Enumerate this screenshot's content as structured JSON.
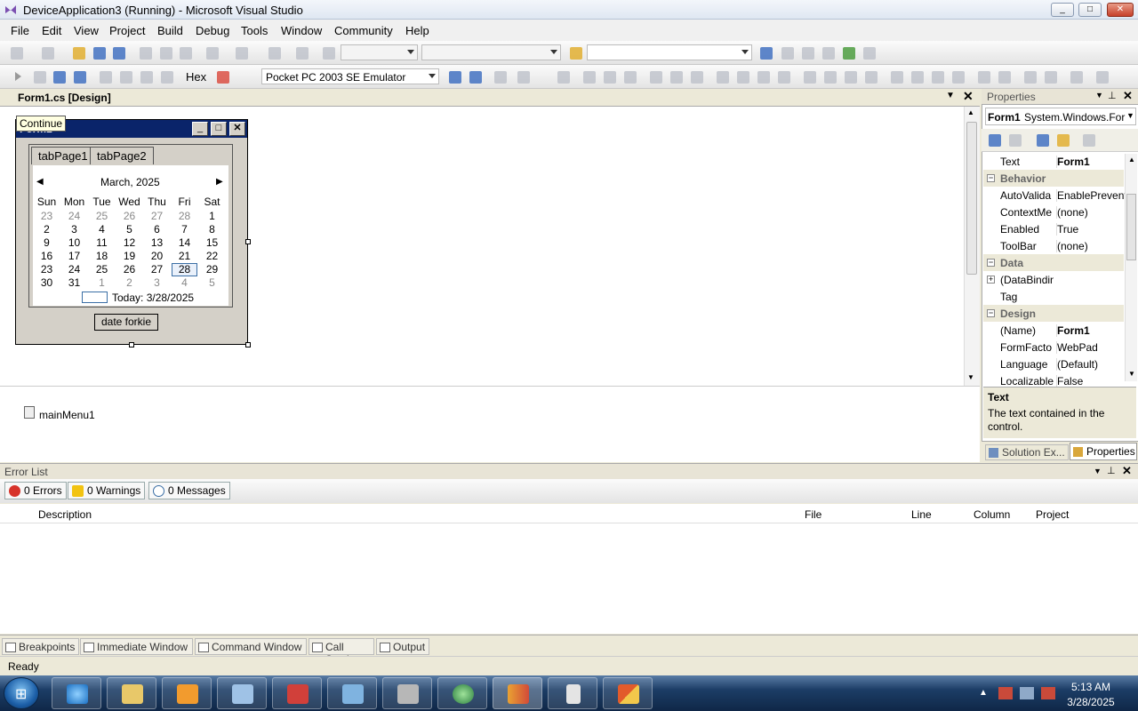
{
  "window": {
    "title": "DeviceApplication3 (Running) - Microsoft Visual Studio",
    "minimize": "_",
    "maximize": "□",
    "close": "✕"
  },
  "menu": [
    "File",
    "Edit",
    "View",
    "Project",
    "Build",
    "Debug",
    "Tools",
    "Window",
    "Community",
    "Help"
  ],
  "toolbar2": {
    "hex_label": "Hex",
    "device": "Pocket PC 2003 SE Emulator"
  },
  "document": {
    "tab": "Form1.cs [Design]",
    "tooltip": "Continue"
  },
  "form": {
    "title": "Form1",
    "tabs": [
      "tabPage1",
      "tabPage2"
    ],
    "button_label": "date forkie",
    "calendar": {
      "month_label": "March, 2025",
      "weekdays": [
        "Sun",
        "Mon",
        "Tue",
        "Wed",
        "Thu",
        "Fri",
        "Sat"
      ],
      "weeks": [
        [
          "23",
          "24",
          "25",
          "26",
          "27",
          "28",
          "1"
        ],
        [
          "2",
          "3",
          "4",
          "5",
          "6",
          "7",
          "8"
        ],
        [
          "9",
          "10",
          "11",
          "12",
          "13",
          "14",
          "15"
        ],
        [
          "16",
          "17",
          "18",
          "19",
          "20",
          "21",
          "22"
        ],
        [
          "23",
          "24",
          "25",
          "26",
          "27",
          "28",
          "29"
        ],
        [
          "30",
          "31",
          "1",
          "2",
          "3",
          "4",
          "5"
        ]
      ],
      "selected": "28",
      "today_label": "Today: 3/28/2025"
    }
  },
  "tray": {
    "component": "mainMenu1"
  },
  "properties": {
    "header": "Properties",
    "object_name": "Form1",
    "object_type": "System.Windows.For",
    "rows": [
      {
        "name": "Text",
        "value": "Form1",
        "bold": true
      },
      {
        "name": "Behavior",
        "category": true
      },
      {
        "name": "AutoValida",
        "value": "EnablePrevent"
      },
      {
        "name": "ContextMe",
        "value": "(none)"
      },
      {
        "name": "Enabled",
        "value": "True"
      },
      {
        "name": "ToolBar",
        "value": "(none)"
      },
      {
        "name": "Data",
        "category": true
      },
      {
        "name": "(DataBindin",
        "value": "",
        "expand": true
      },
      {
        "name": "Tag",
        "value": ""
      },
      {
        "name": "Design",
        "category": true
      },
      {
        "name": "(Name)",
        "value": "Form1",
        "bold": true
      },
      {
        "name": "FormFacto",
        "value": "WebPad"
      },
      {
        "name": "Language",
        "value": "(Default)"
      },
      {
        "name": "Localizable",
        "value": "False"
      }
    ],
    "desc_title": "Text",
    "desc_text": "The text contained in the control.",
    "tab_solution": "Solution Ex...",
    "tab_properties": "Properties"
  },
  "error_list": {
    "header": "Error List",
    "errors": "0 Errors",
    "warnings": "0 Warnings",
    "messages": "0 Messages",
    "columns": [
      "Description",
      "File",
      "Line",
      "Column",
      "Project"
    ]
  },
  "bottom_tabs": [
    "Breakpoints",
    "Immediate Window",
    "Command Window",
    "Call Stack",
    "Output"
  ],
  "status": "Ready",
  "clock": {
    "time": "5:13 AM",
    "date": "3/28/2025"
  },
  "colors": {
    "form_title": "#0a246a",
    "accent": "#3a6ea5"
  }
}
